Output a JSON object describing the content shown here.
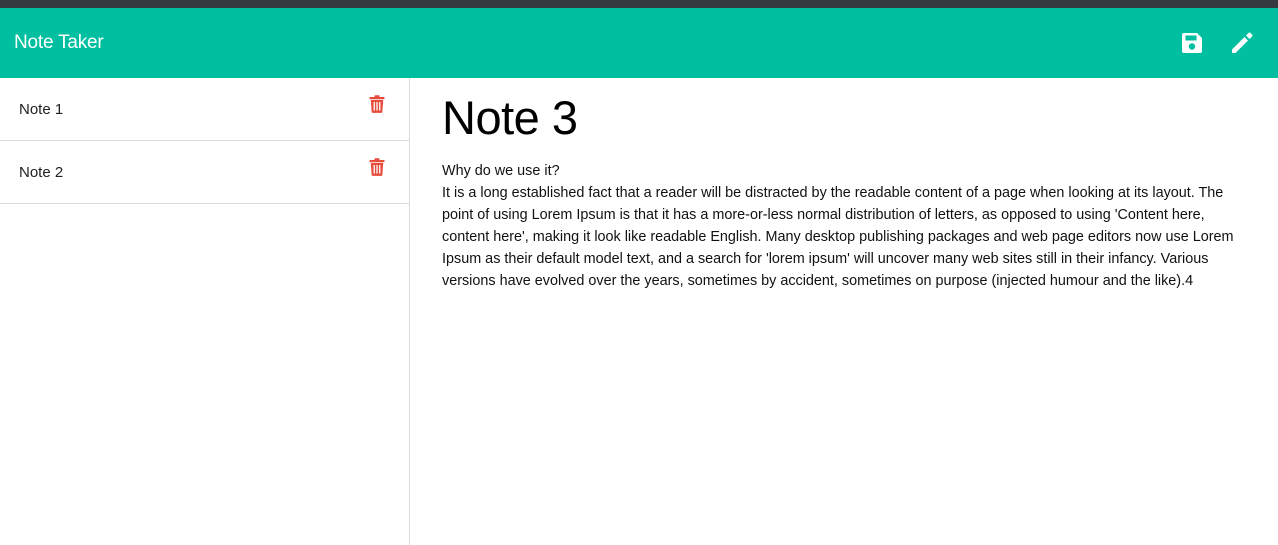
{
  "navbar": {
    "brand": "Note Taker",
    "icons": [
      "save-icon",
      "pencil-icon"
    ],
    "background": "#00bfa0"
  },
  "sidebar": {
    "notes": [
      {
        "title": "Note 1",
        "icon": "trash-icon"
      },
      {
        "title": "Note 2",
        "icon": "trash-icon"
      }
    ],
    "delete_color": "#e74c3c"
  },
  "active_note": {
    "title": "Note 3",
    "text": "Why do we use it?\nIt is a long established fact that a reader will be distracted by the readable content of a page when looking at its layout. The point of using Lorem Ipsum is that it has a more-or-less normal distribution of letters, as opposed to using 'Content here, content here', making it look like readable English. Many desktop publishing packages and web page editors now use Lorem Ipsum as their default model text, and a search for 'lorem ipsum' will uncover many web sites still in their infancy. Various versions have evolved over the years, sometimes by accident, sometimes on purpose (injected humour and the like).4"
  }
}
